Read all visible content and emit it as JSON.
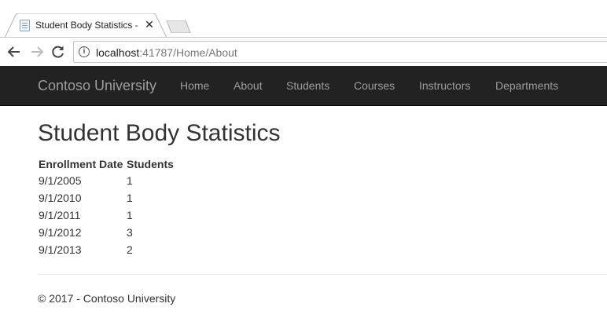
{
  "browser": {
    "tab_title": "Student Body Statistics -",
    "url_host": "localhost",
    "url_rest": ":41787/Home/About",
    "icons": [
      "page-icon",
      "close-icon",
      "back-icon",
      "forward-icon",
      "reload-icon",
      "info-icon"
    ]
  },
  "navbar": {
    "brand": "Contoso University",
    "links": [
      "Home",
      "About",
      "Students",
      "Courses",
      "Instructors",
      "Departments"
    ],
    "background": "#222222",
    "link_color": "#9d9d9d"
  },
  "main": {
    "title": "Student Body Statistics",
    "table": {
      "headers": [
        "Enrollment Date",
        "Students"
      ],
      "rows": [
        [
          "9/1/2005",
          "1"
        ],
        [
          "9/1/2010",
          "1"
        ],
        [
          "9/1/2011",
          "1"
        ],
        [
          "9/1/2012",
          "3"
        ],
        [
          "9/1/2013",
          "2"
        ]
      ]
    }
  },
  "footer": {
    "text": "© 2017 - Contoso University"
  }
}
